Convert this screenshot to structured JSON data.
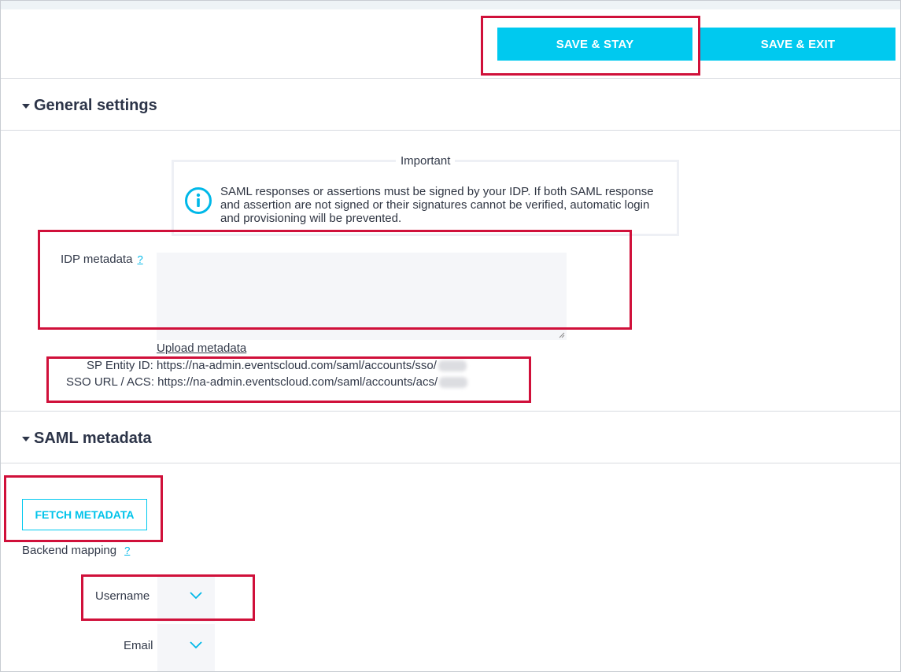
{
  "toolbar": {
    "save_stay_label": "SAVE & STAY",
    "save_exit_label": "SAVE & EXIT"
  },
  "general": {
    "title": "General settings",
    "important_title": "Important",
    "important_text": "SAML responses or assertions must be signed by your IDP. If both SAML response and assertion are not signed or their signatures cannot be verified, automatic login and provisioning will be prevented.",
    "idp_label": "IDP metadata",
    "help_glyph": "?",
    "idp_value": "",
    "upload_link": "Upload metadata",
    "sp_entity_label": "SP Entity ID:",
    "sp_entity_url": "https://na-admin.eventscloud.com/saml/accounts/sso/",
    "sso_label": "SSO URL / ACS:",
    "sso_url": "https://na-admin.eventscloud.com/saml/accounts/acs/"
  },
  "saml": {
    "title": "SAML metadata",
    "fetch_label": "FETCH METADATA",
    "backend_label": "Backend mapping",
    "help_glyph": "?",
    "fields": [
      {
        "label": "Username",
        "value": ""
      },
      {
        "label": "Email",
        "value": ""
      }
    ]
  },
  "colors": {
    "accent": "#00c9ef",
    "highlight": "#d0103a",
    "heading": "#2c3448"
  },
  "icons": {
    "info": "info-icon",
    "chevron": "chevron-down-icon",
    "caret": "caret-down-icon"
  }
}
